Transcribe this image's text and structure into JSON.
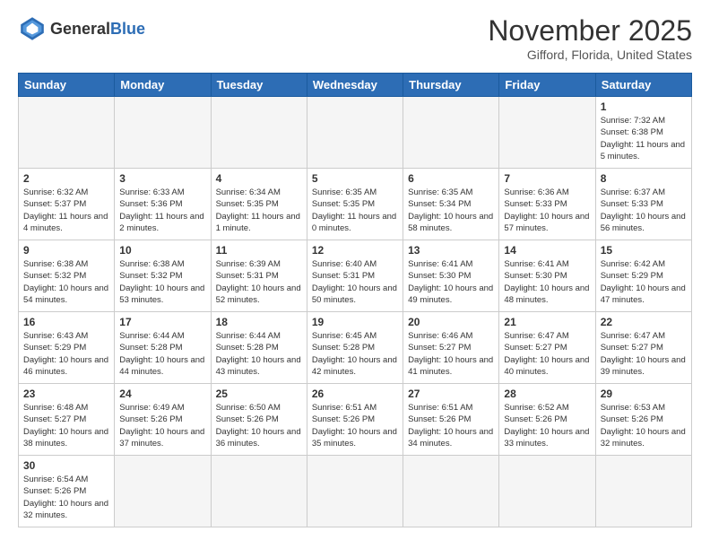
{
  "header": {
    "logo_general": "General",
    "logo_blue": "Blue",
    "month_title": "November 2025",
    "location": "Gifford, Florida, United States"
  },
  "days_of_week": [
    "Sunday",
    "Monday",
    "Tuesday",
    "Wednesday",
    "Thursday",
    "Friday",
    "Saturday"
  ],
  "weeks": [
    [
      {
        "day": "",
        "info": ""
      },
      {
        "day": "",
        "info": ""
      },
      {
        "day": "",
        "info": ""
      },
      {
        "day": "",
        "info": ""
      },
      {
        "day": "",
        "info": ""
      },
      {
        "day": "",
        "info": ""
      },
      {
        "day": "1",
        "info": "Sunrise: 7:32 AM\nSunset: 6:38 PM\nDaylight: 11 hours\nand 5 minutes."
      }
    ],
    [
      {
        "day": "2",
        "info": "Sunrise: 6:32 AM\nSunset: 5:37 PM\nDaylight: 11 hours\nand 4 minutes."
      },
      {
        "day": "3",
        "info": "Sunrise: 6:33 AM\nSunset: 5:36 PM\nDaylight: 11 hours\nand 2 minutes."
      },
      {
        "day": "4",
        "info": "Sunrise: 6:34 AM\nSunset: 5:35 PM\nDaylight: 11 hours\nand 1 minute."
      },
      {
        "day": "5",
        "info": "Sunrise: 6:35 AM\nSunset: 5:35 PM\nDaylight: 11 hours\nand 0 minutes."
      },
      {
        "day": "6",
        "info": "Sunrise: 6:35 AM\nSunset: 5:34 PM\nDaylight: 10 hours\nand 58 minutes."
      },
      {
        "day": "7",
        "info": "Sunrise: 6:36 AM\nSunset: 5:33 PM\nDaylight: 10 hours\nand 57 minutes."
      },
      {
        "day": "8",
        "info": "Sunrise: 6:37 AM\nSunset: 5:33 PM\nDaylight: 10 hours\nand 56 minutes."
      }
    ],
    [
      {
        "day": "9",
        "info": "Sunrise: 6:38 AM\nSunset: 5:32 PM\nDaylight: 10 hours\nand 54 minutes."
      },
      {
        "day": "10",
        "info": "Sunrise: 6:38 AM\nSunset: 5:32 PM\nDaylight: 10 hours\nand 53 minutes."
      },
      {
        "day": "11",
        "info": "Sunrise: 6:39 AM\nSunset: 5:31 PM\nDaylight: 10 hours\nand 52 minutes."
      },
      {
        "day": "12",
        "info": "Sunrise: 6:40 AM\nSunset: 5:31 PM\nDaylight: 10 hours\nand 50 minutes."
      },
      {
        "day": "13",
        "info": "Sunrise: 6:41 AM\nSunset: 5:30 PM\nDaylight: 10 hours\nand 49 minutes."
      },
      {
        "day": "14",
        "info": "Sunrise: 6:41 AM\nSunset: 5:30 PM\nDaylight: 10 hours\nand 48 minutes."
      },
      {
        "day": "15",
        "info": "Sunrise: 6:42 AM\nSunset: 5:29 PM\nDaylight: 10 hours\nand 47 minutes."
      }
    ],
    [
      {
        "day": "16",
        "info": "Sunrise: 6:43 AM\nSunset: 5:29 PM\nDaylight: 10 hours\nand 46 minutes."
      },
      {
        "day": "17",
        "info": "Sunrise: 6:44 AM\nSunset: 5:28 PM\nDaylight: 10 hours\nand 44 minutes."
      },
      {
        "day": "18",
        "info": "Sunrise: 6:44 AM\nSunset: 5:28 PM\nDaylight: 10 hours\nand 43 minutes."
      },
      {
        "day": "19",
        "info": "Sunrise: 6:45 AM\nSunset: 5:28 PM\nDaylight: 10 hours\nand 42 minutes."
      },
      {
        "day": "20",
        "info": "Sunrise: 6:46 AM\nSunset: 5:27 PM\nDaylight: 10 hours\nand 41 minutes."
      },
      {
        "day": "21",
        "info": "Sunrise: 6:47 AM\nSunset: 5:27 PM\nDaylight: 10 hours\nand 40 minutes."
      },
      {
        "day": "22",
        "info": "Sunrise: 6:47 AM\nSunset: 5:27 PM\nDaylight: 10 hours\nand 39 minutes."
      }
    ],
    [
      {
        "day": "23",
        "info": "Sunrise: 6:48 AM\nSunset: 5:27 PM\nDaylight: 10 hours\nand 38 minutes."
      },
      {
        "day": "24",
        "info": "Sunrise: 6:49 AM\nSunset: 5:26 PM\nDaylight: 10 hours\nand 37 minutes."
      },
      {
        "day": "25",
        "info": "Sunrise: 6:50 AM\nSunset: 5:26 PM\nDaylight: 10 hours\nand 36 minutes."
      },
      {
        "day": "26",
        "info": "Sunrise: 6:51 AM\nSunset: 5:26 PM\nDaylight: 10 hours\nand 35 minutes."
      },
      {
        "day": "27",
        "info": "Sunrise: 6:51 AM\nSunset: 5:26 PM\nDaylight: 10 hours\nand 34 minutes."
      },
      {
        "day": "28",
        "info": "Sunrise: 6:52 AM\nSunset: 5:26 PM\nDaylight: 10 hours\nand 33 minutes."
      },
      {
        "day": "29",
        "info": "Sunrise: 6:53 AM\nSunset: 5:26 PM\nDaylight: 10 hours\nand 32 minutes."
      }
    ],
    [
      {
        "day": "30",
        "info": "Sunrise: 6:54 AM\nSunset: 5:26 PM\nDaylight: 10 hours\nand 32 minutes."
      },
      {
        "day": "",
        "info": ""
      },
      {
        "day": "",
        "info": ""
      },
      {
        "day": "",
        "info": ""
      },
      {
        "day": "",
        "info": ""
      },
      {
        "day": "",
        "info": ""
      },
      {
        "day": "",
        "info": ""
      }
    ]
  ]
}
